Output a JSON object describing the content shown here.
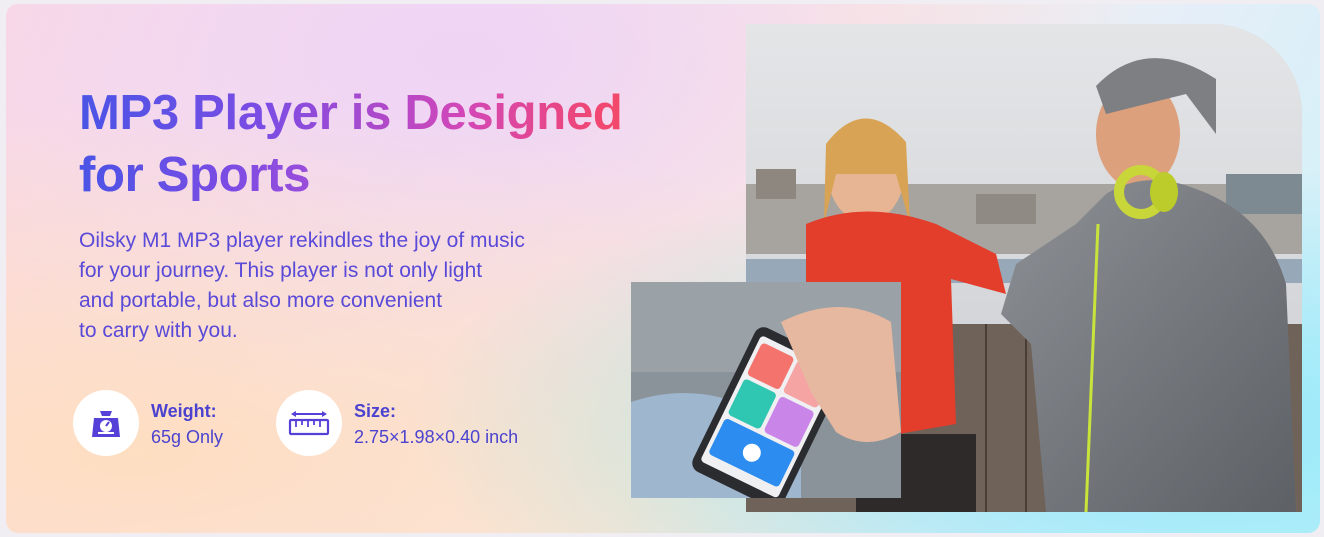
{
  "title": {
    "line1": "MP3 Player is Designed",
    "line2": "for Sports"
  },
  "description": {
    "lines": [
      "Oilsky M1 MP3 player rekindles the joy of music",
      "for your journey. This player is not only light",
      "and portable, but also more convenient",
      "to carry with you."
    ]
  },
  "specs": {
    "weight": {
      "icon": "scale-icon",
      "label": "Weight:",
      "value": "65g Only"
    },
    "size": {
      "icon": "ruler-icon",
      "label": "Size:",
      "value": "2.75×1.98×0.40 inch"
    }
  },
  "photo": {
    "subject": "photo-couple-sports",
    "inset": "photo-player-in-pocket",
    "screen_tiles": [
      "music",
      "96.6",
      "bluetooth",
      "voice"
    ]
  },
  "colors": {
    "title_start": "#4a54e6",
    "title_end": "#f35a52",
    "text": "#5a4ad8",
    "spec_text": "#4b43cf"
  }
}
